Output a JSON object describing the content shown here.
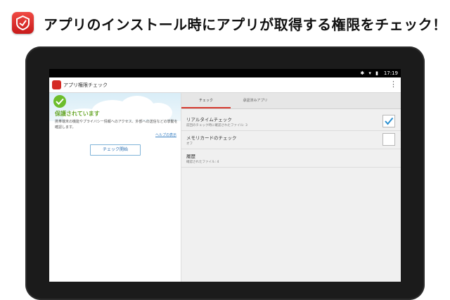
{
  "headline": "アプリのインストール時にアプリが取得する権限をチェック！",
  "statusbar": {
    "icons": "✱ ▾ ▮",
    "time": "17:19"
  },
  "actionbar": {
    "title": "アプリ権限チェック"
  },
  "left_pane": {
    "status_title": "保護されています",
    "description": "携帯端末の機能やプライバシー情報へのアクセス、外部への送信などの挙動を確認します。",
    "help_link": "ヘルプの表示",
    "check_button": "チェック開始"
  },
  "tabs": [
    {
      "label": "チェック"
    },
    {
      "label": "承認済みアプリ"
    }
  ],
  "rows": [
    {
      "title": "リアルタイムチェック",
      "subtitle": "前回のチェック時に確認されたファイル: 3",
      "checked": true
    },
    {
      "title": "メモリカードのチェック",
      "subtitle": "オフ",
      "checked": false
    },
    {
      "title": "履歴",
      "subtitle": "確認されたファイル: 4"
    }
  ],
  "colors": {
    "accent": "#d63a30",
    "protected_green": "#6cbd2b",
    "check_blue": "#2a8fd0"
  }
}
